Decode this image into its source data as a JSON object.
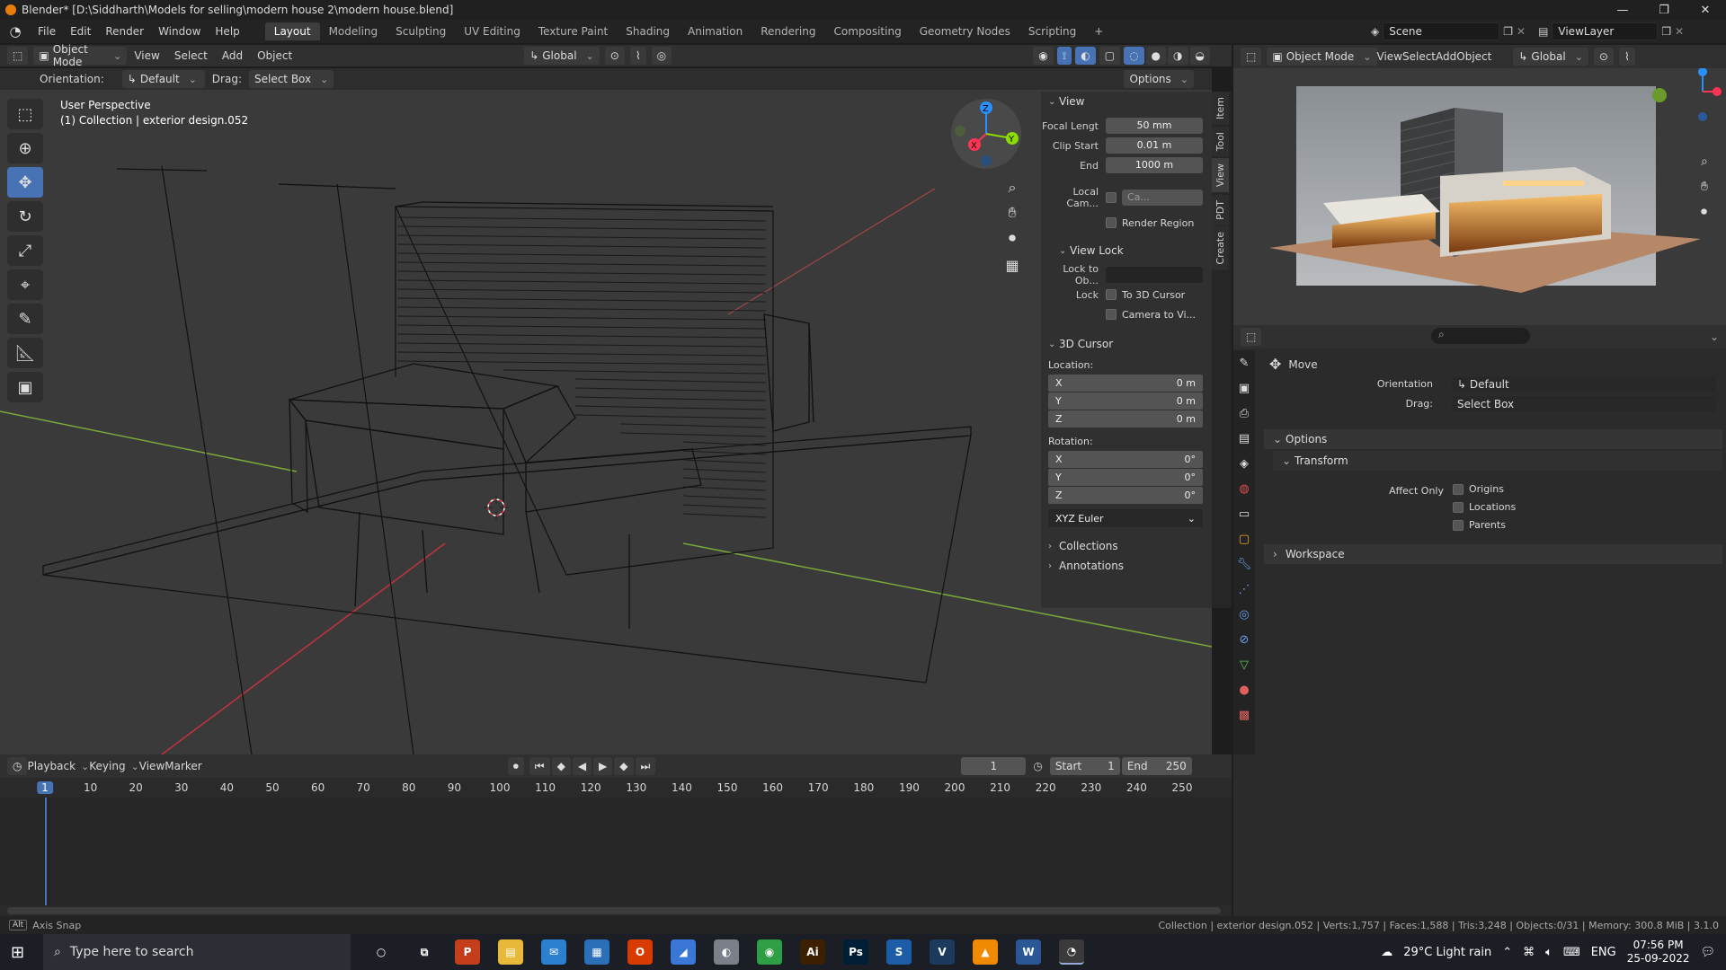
{
  "window": {
    "title": "Blender* [D:\\Siddharth\\Models for selling\\modern house 2\\modern house.blend]",
    "controls": [
      "—",
      "❐",
      "✕"
    ]
  },
  "menu": {
    "items": [
      "File",
      "Edit",
      "Render",
      "Window",
      "Help"
    ],
    "workspaces": [
      "Layout",
      "Modeling",
      "Sculpting",
      "UV Editing",
      "Texture Paint",
      "Shading",
      "Animation",
      "Rendering",
      "Compositing",
      "Geometry Nodes",
      "Scripting"
    ],
    "add_tab": "+",
    "scene": "Scene",
    "viewlayer": "ViewLayer"
  },
  "viewport_header": {
    "mode": "Object Mode",
    "menus": [
      "View",
      "Select",
      "Add",
      "Object"
    ],
    "transform": "Global",
    "orientation_label": "Orientation:",
    "orientation_value": "Default",
    "drag_label": "Drag:",
    "drag_value": "Select Box",
    "options": "Options"
  },
  "viewport": {
    "perspective": "User Perspective",
    "collection": "(1) Collection | exterior design.052",
    "gizmo_axes": [
      "X",
      "Y",
      "Z"
    ]
  },
  "npanel": {
    "view_section": "View",
    "focal_label": "Focal Lengt",
    "focal_value": "50 mm",
    "clip_start_label": "Clip Start",
    "clip_start_value": "0.01 m",
    "end_label": "End",
    "end_value": "1000 m",
    "local_cam_label": "Local Cam...",
    "local_cam_value": "Ca...",
    "render_region": "Render Region",
    "view_lock_section": "View Lock",
    "lock_to_obj_label": "Lock to Ob...",
    "lock_label": "Lock",
    "to_3d_cursor": "To 3D Cursor",
    "camera_to_view": "Camera to Vi...",
    "cursor_section": "3D Cursor",
    "location_label": "Location:",
    "loc": [
      {
        "axis": "X",
        "value": "0 m"
      },
      {
        "axis": "Y",
        "value": "0 m"
      },
      {
        "axis": "Z",
        "value": "0 m"
      }
    ],
    "rotation_label": "Rotation:",
    "rot": [
      {
        "axis": "X",
        "value": "0°"
      },
      {
        "axis": "Y",
        "value": "0°"
      },
      {
        "axis": "Z",
        "value": "0°"
      }
    ],
    "rotation_mode": "XYZ Euler",
    "collections": "Collections",
    "annotations": "Annotations",
    "tabs": [
      "Item",
      "Tool",
      "View",
      "PDT",
      "Create"
    ]
  },
  "right_header": {
    "mode": "Object Mode",
    "menus": [
      "View",
      "Select",
      "Add",
      "Object"
    ],
    "transform": "Global"
  },
  "properties": {
    "tool_name": "Move",
    "orientation_label": "Orientation",
    "orientation_value": "Default",
    "drag_label": "Drag:",
    "drag_value": "Select Box",
    "options_section": "Options",
    "transform_section": "Transform",
    "affect_only_label": "Affect Only",
    "origins": "Origins",
    "locations": "Locations",
    "parents": "Parents",
    "workspace_section": "Workspace"
  },
  "timeline": {
    "menus": [
      "Playback",
      "Keying",
      "View",
      "Marker"
    ],
    "current_frame": "1",
    "start_label": "Start",
    "start_value": "1",
    "end_label": "End",
    "end_value": "250",
    "ruler": [
      "1",
      "10",
      "20",
      "30",
      "40",
      "50",
      "60",
      "70",
      "80",
      "90",
      "100",
      "110",
      "120",
      "130",
      "140",
      "150",
      "160",
      "170",
      "180",
      "190",
      "200",
      "210",
      "220",
      "230",
      "240",
      "250"
    ]
  },
  "statusbar": {
    "left": "Axis Snap",
    "right": "Collection | exterior design.052 | Verts:1,757 | Faces:1,588 | Tris:3,248 | Objects:0/31 | Memory: 300.8 MiB | 3.1.0"
  },
  "taskbar": {
    "search_placeholder": "Type here to search",
    "apps": [
      {
        "name": "cortana",
        "label": "○",
        "color": "#1b1e25"
      },
      {
        "name": "task-view",
        "label": "⧉",
        "color": "#1b1e25"
      },
      {
        "name": "powerpoint",
        "label": "P",
        "color": "#c43e1c"
      },
      {
        "name": "file-explorer",
        "label": "▤",
        "color": "#e8b83a"
      },
      {
        "name": "mail",
        "label": "✉",
        "color": "#2a7fcf"
      },
      {
        "name": "store",
        "label": "▦",
        "color": "#2b6fb8"
      },
      {
        "name": "office",
        "label": "O",
        "color": "#d83b01"
      },
      {
        "name": "app-blue",
        "label": "◢",
        "color": "#3a78d8"
      },
      {
        "name": "app-gray",
        "label": "◐",
        "color": "#7a7f88"
      },
      {
        "name": "chrome",
        "label": "◉",
        "color": "#2f9e44"
      },
      {
        "name": "illustrator",
        "label": "Ai",
        "color": "#3b1f00"
      },
      {
        "name": "photoshop",
        "label": "Ps",
        "color": "#001e36"
      },
      {
        "name": "sketchup",
        "label": "S",
        "color": "#1c5da8"
      },
      {
        "name": "vray",
        "label": "V",
        "color": "#1b3a5c"
      },
      {
        "name": "vlc",
        "label": "▲",
        "color": "#f08a00"
      },
      {
        "name": "word",
        "label": "W",
        "color": "#2b5797"
      },
      {
        "name": "blender",
        "label": "◔",
        "color": "#3a3a3a"
      }
    ],
    "weather": "29°C  Light rain",
    "lang": "ENG",
    "time": "07:56 PM",
    "date": "25-09-2022"
  },
  "colors": {
    "accent": "#4772b3",
    "x_axis": "#ff3352",
    "y_axis": "#8bdc00",
    "z_axis": "#2890ff"
  }
}
